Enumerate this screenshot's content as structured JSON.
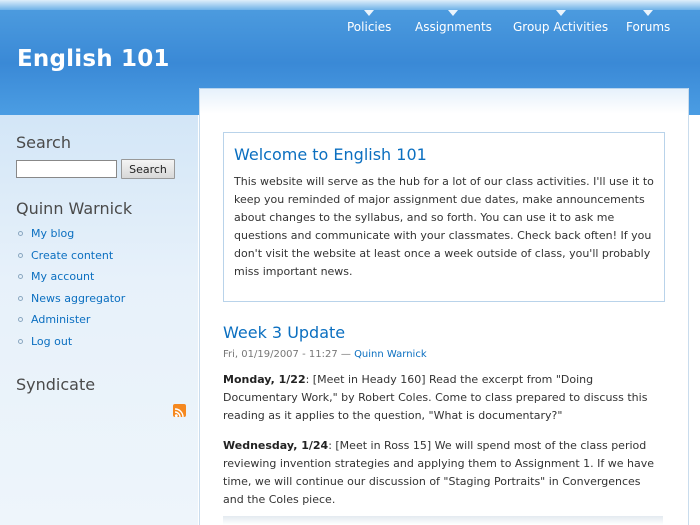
{
  "site": {
    "name": "English 101"
  },
  "nav": {
    "items": [
      {
        "label": "Policies"
      },
      {
        "label": "Assignments"
      },
      {
        "label": "Group Activities"
      },
      {
        "label": "Forums"
      }
    ]
  },
  "sidebar": {
    "search": {
      "title": "Search",
      "button_label": "Search",
      "input_value": ""
    },
    "user": {
      "title": "Quinn Warnick",
      "links": [
        "My blog",
        "Create content",
        "My account",
        "News aggregator",
        "Administer",
        "Log out"
      ]
    },
    "syndicate": {
      "title": "Syndicate",
      "icon": "rss-icon"
    }
  },
  "welcome": {
    "title": "Welcome to English 101",
    "body": "This website will serve as the hub for a lot of our class activities. I'll use it to keep you reminded of major assignment due dates, make announcements about changes to the syllabus, and so forth. You can use it to ask me questions and communicate with your classmates. Check back often! If you don't visit the website at least once a week outside of class, you'll probably miss important news."
  },
  "post": {
    "title": "Week 3 Update",
    "meta_date": "Fri, 01/19/2007 - 11:27 — ",
    "author": "Quinn Warnick",
    "paragraphs": [
      {
        "day": "Monday, 1/22",
        "text": ": [Meet in Heady 160] Read the excerpt from \"Doing Documentary Work,\" by Robert Coles. Come to class prepared to discuss this reading as it applies to the question, \"What is documentary?\""
      },
      {
        "day": "Wednesday, 1/24",
        "text": ": [Meet in Ross 15] We will spend most of the class period reviewing invention strategies and applying them to Assignment 1. If we have time, we will continue our discussion of \"Staging Portraits\" in Convergences and the Coles piece."
      }
    ]
  },
  "colors": {
    "header_blue": "#3a89d6",
    "link_blue": "#0b6fc0",
    "sidebar_bg": "#e7f1fa",
    "rss_orange": "#f5881f"
  }
}
